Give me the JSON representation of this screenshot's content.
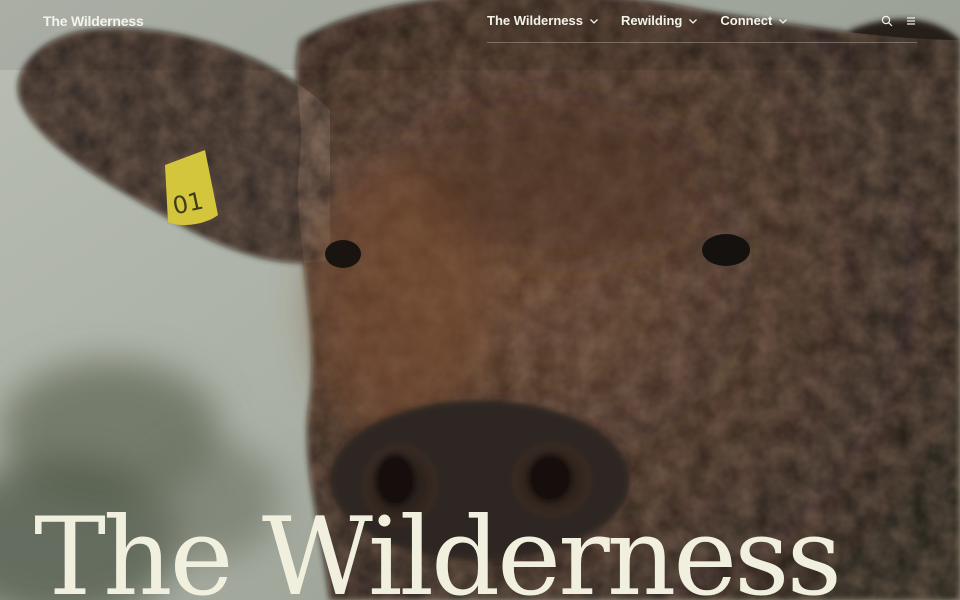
{
  "header": {
    "logo_text": "The Wilderness",
    "nav": [
      {
        "label": "The Wilderness",
        "has_dropdown": true
      },
      {
        "label": "Rewilding",
        "has_dropdown": true
      },
      {
        "label": "Connect",
        "has_dropdown": true
      }
    ],
    "icons": [
      "search-icon",
      "menu-icon"
    ]
  },
  "hero": {
    "title": "The Wilderness",
    "image_subject": "close-up of a dark curly-coated calf with a yellow ear tag",
    "ear_tag_text": "01"
  },
  "colors": {
    "text_light": "#f4f3ea",
    "title_cream": "#f1f0df",
    "ear_tag_yellow": "#d4c63c",
    "coat_dark": "#2e241e"
  }
}
